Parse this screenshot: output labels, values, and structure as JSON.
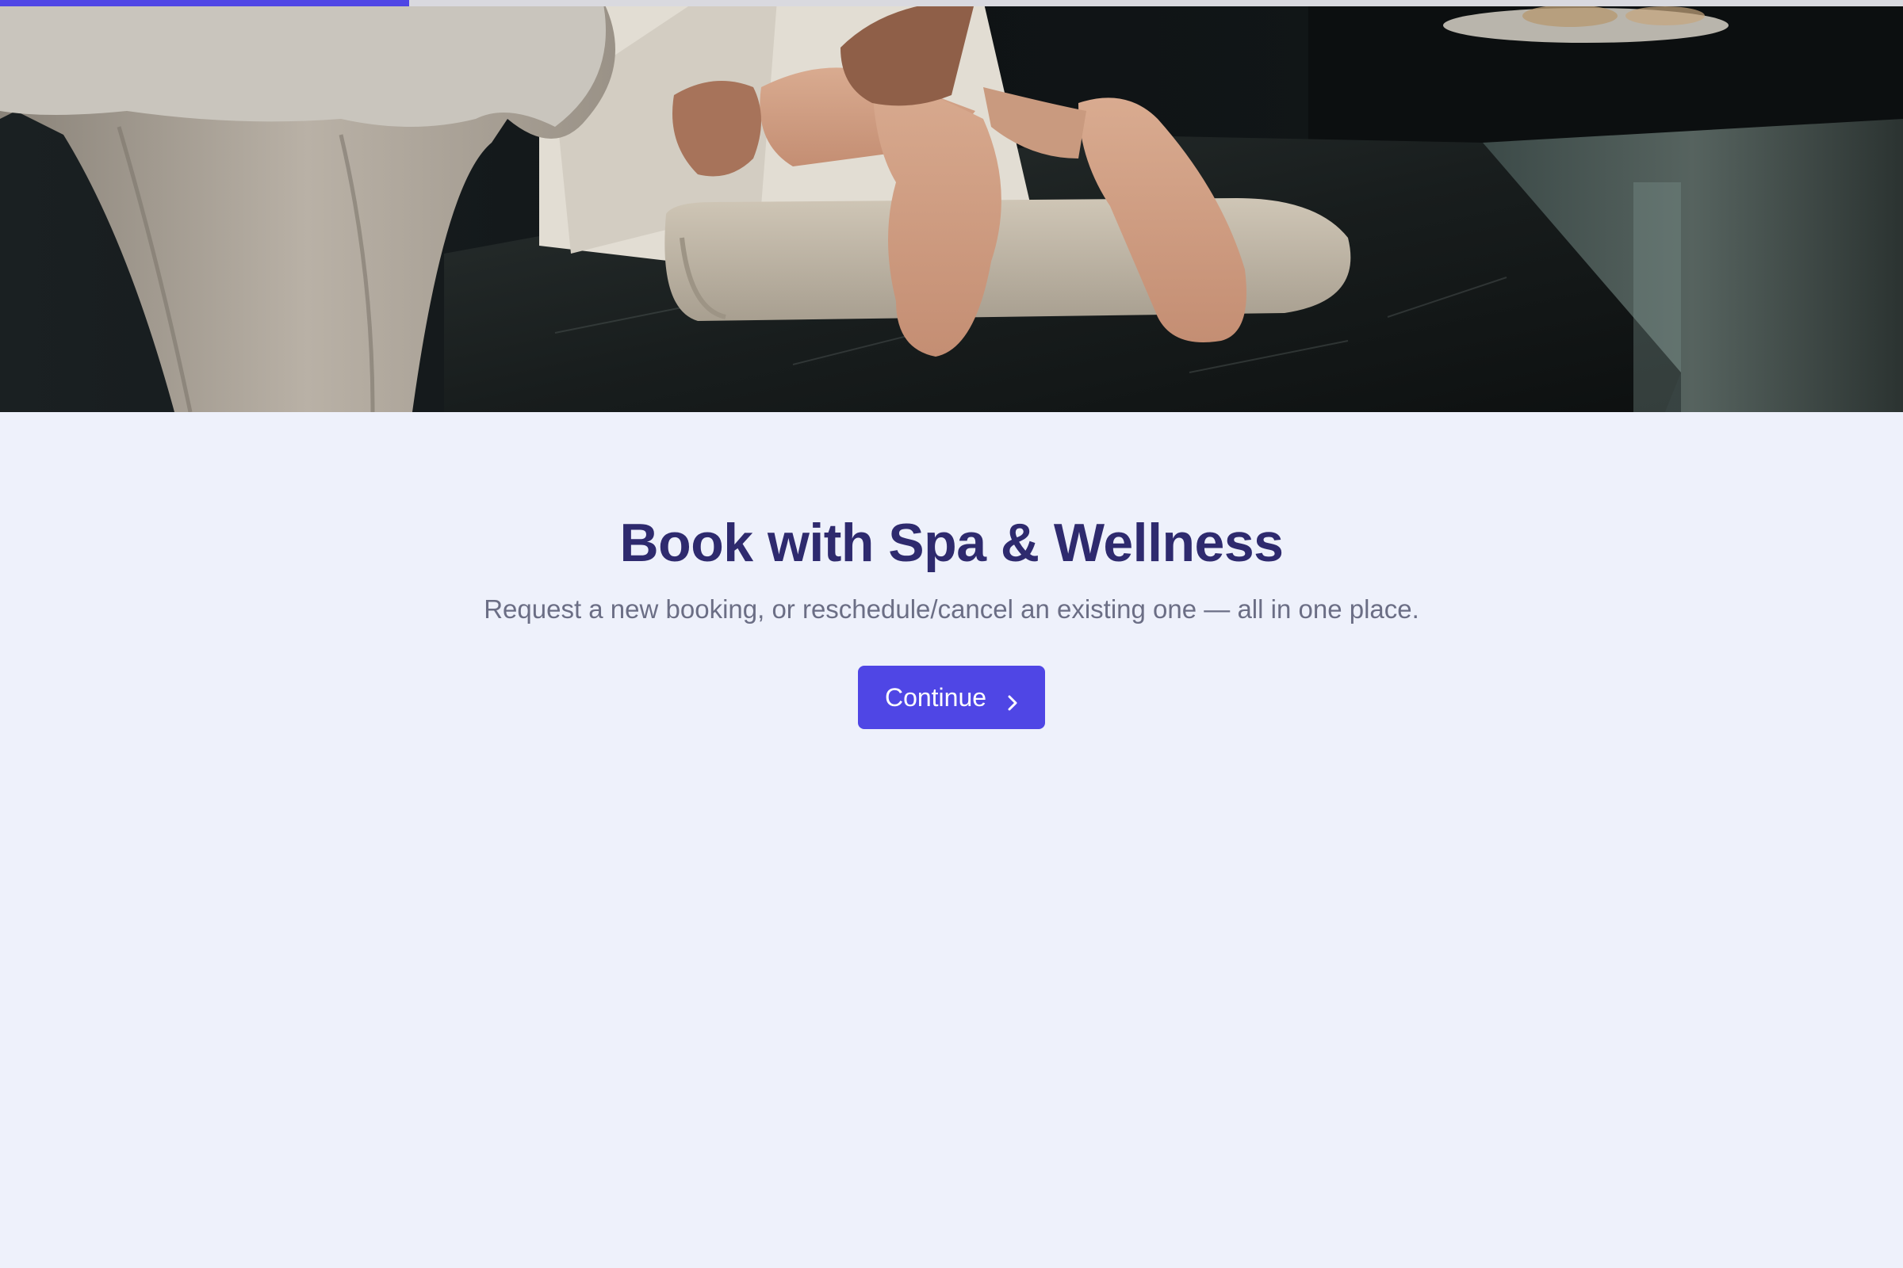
{
  "progress": {
    "value": 0.215
  },
  "hero": {
    "image": "spa-massage-feet-photo"
  },
  "main": {
    "title": "Book with Spa & Wellness",
    "subtitle": "Request a new booking, or reschedule/cancel an existing one — all in one place.",
    "continue_label": "Continue",
    "continue_icon": "chevron-right-icon"
  },
  "colors": {
    "accent": "#4f46e5",
    "title": "#2e2a6e",
    "subtitle": "#6b6e85",
    "background": "#eef1fb"
  }
}
